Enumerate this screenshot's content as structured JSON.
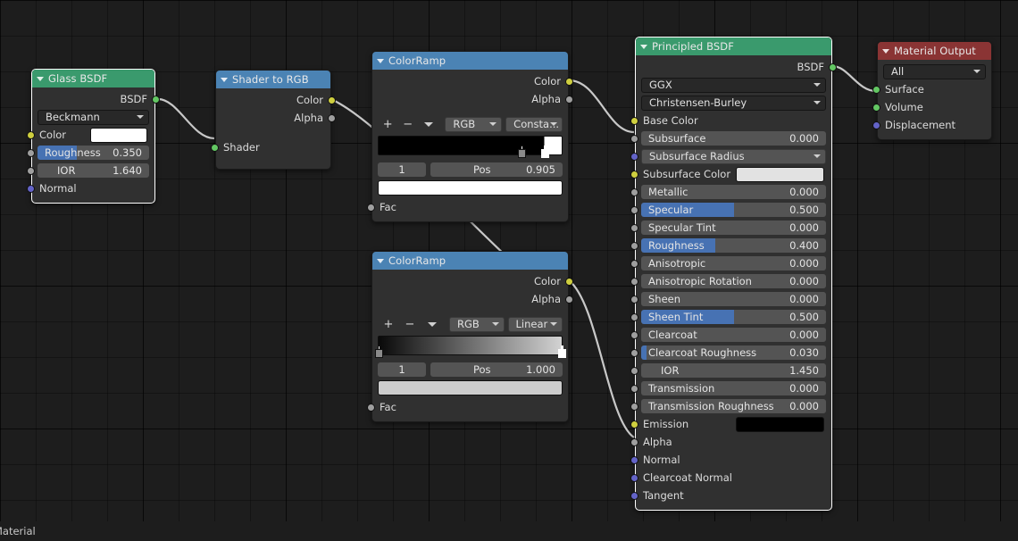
{
  "editor": {
    "background_color": "#1d1d1d",
    "wire_color": "#c8c8c8",
    "statusbar_text": "Material"
  },
  "nodes": {
    "glass_bsdf": {
      "title": "Glass BSDF",
      "header_color": "#3a9a6d",
      "outputs": [
        {
          "label": "BSDF",
          "socket": "shader-socket",
          "color": "#63c763"
        }
      ],
      "distribution": "Beckmann",
      "inputs": [
        {
          "label": "Color",
          "socket": "color-socket",
          "color": "#cfcf3f",
          "widget": "swatch",
          "value": "#ffffff"
        },
        {
          "label": "Roughness",
          "socket": "value-socket",
          "color": "#9f9f9f",
          "widget": "slider",
          "value": "0.350",
          "fill": 35
        },
        {
          "label": "IOR",
          "socket": "value-socket",
          "color": "#9f9f9f",
          "widget": "slider",
          "value": "1.640",
          "fill": 0
        },
        {
          "label": "Normal",
          "socket": "vector-socket",
          "color": "#6363c7",
          "widget": "none",
          "value": ""
        }
      ]
    },
    "shader_to_rgb": {
      "title": "Shader to RGB",
      "header_color": "#4b83b4",
      "outputs": [
        {
          "label": "Color",
          "socket": "color-socket",
          "color": "#cfcf3f"
        },
        {
          "label": "Alpha",
          "socket": "value-socket",
          "color": "#9f9f9f"
        }
      ],
      "inputs": [
        {
          "label": "Shader",
          "socket": "shader-socket",
          "color": "#63c763"
        }
      ]
    },
    "colorramp_1": {
      "title": "ColorRamp",
      "header_color": "#4b83b4",
      "outputs": [
        {
          "label": "Color",
          "socket": "color-socket",
          "color": "#cfcf3f"
        },
        {
          "label": "Alpha",
          "socket": "value-socket",
          "color": "#9f9f9f"
        }
      ],
      "tools": {
        "add": "+",
        "remove": "−",
        "menu": "chevron-down-icon"
      },
      "color_mode": "RGB",
      "interpolation": "Consta...",
      "gradient_css": "linear-gradient(to right, #000000 0%, #000000 90.5%, #ffffff 90.5%, #ffffff 100%)",
      "stops": [
        {
          "pos": 0.0,
          "color": "#000000",
          "selected": false
        },
        {
          "pos": 0.86,
          "color": "#000000",
          "selected": false
        },
        {
          "pos": 0.905,
          "color": "#ffffff",
          "selected": true
        }
      ],
      "index": "1",
      "pos_label": "Pos",
      "pos_value": "0.905",
      "active_color": "#ffffff",
      "inputs": [
        {
          "label": "Fac",
          "socket": "value-socket",
          "color": "#9f9f9f"
        }
      ]
    },
    "colorramp_2": {
      "title": "ColorRamp",
      "header_color": "#4b83b4",
      "outputs": [
        {
          "label": "Color",
          "socket": "color-socket",
          "color": "#cfcf3f"
        },
        {
          "label": "Alpha",
          "socket": "value-socket",
          "color": "#9f9f9f"
        }
      ],
      "tools": {
        "add": "+",
        "remove": "−",
        "menu": "chevron-down-icon"
      },
      "color_mode": "RGB",
      "interpolation": "Linear",
      "gradient_css": "linear-gradient(to right, #090909 0%, #d2d2d2 100%)",
      "stops": [
        {
          "pos": 0.0,
          "color": "#000000",
          "selected": false
        },
        {
          "pos": 1.0,
          "color": "#d2d2d2",
          "selected": true
        }
      ],
      "index": "1",
      "pos_label": "Pos",
      "pos_value": "1.000",
      "active_color": "#cdcdcd",
      "inputs": [
        {
          "label": "Fac",
          "socket": "value-socket",
          "color": "#9f9f9f"
        }
      ]
    },
    "principled_bsdf": {
      "title": "Principled BSDF",
      "header_color": "#3a9a6d",
      "outputs": [
        {
          "label": "BSDF",
          "socket": "shader-socket",
          "color": "#63c763"
        }
      ],
      "distribution": "GGX",
      "subsurface_method": "Christensen-Burley",
      "inputs": [
        {
          "label": "Base Color",
          "socket": "color-socket",
          "color": "#cfcf3f",
          "widget": "none",
          "value": ""
        },
        {
          "label": "Subsurface",
          "socket": "value-socket",
          "color": "#9f9f9f",
          "widget": "slider",
          "value": "0.000",
          "fill": 0
        },
        {
          "label": "Subsurface Radius",
          "socket": "vector-socket",
          "color": "#6363c7",
          "widget": "dropdown",
          "value": ""
        },
        {
          "label": "Subsurface Color",
          "socket": "color-socket",
          "color": "#cfcf3f",
          "widget": "swatch",
          "value": "#e2e2e2"
        },
        {
          "label": "Metallic",
          "socket": "value-socket",
          "color": "#9f9f9f",
          "widget": "slider",
          "value": "0.000",
          "fill": 0
        },
        {
          "label": "Specular",
          "socket": "value-socket",
          "color": "#9f9f9f",
          "widget": "slider",
          "value": "0.500",
          "fill": 50
        },
        {
          "label": "Specular Tint",
          "socket": "value-socket",
          "color": "#9f9f9f",
          "widget": "slider",
          "value": "0.000",
          "fill": 0
        },
        {
          "label": "Roughness",
          "socket": "value-socket",
          "color": "#9f9f9f",
          "widget": "slider",
          "value": "0.400",
          "fill": 40
        },
        {
          "label": "Anisotropic",
          "socket": "value-socket",
          "color": "#9f9f9f",
          "widget": "slider",
          "value": "0.000",
          "fill": 0
        },
        {
          "label": "Anisotropic Rotation",
          "socket": "value-socket",
          "color": "#9f9f9f",
          "widget": "slider",
          "value": "0.000",
          "fill": 0
        },
        {
          "label": "Sheen",
          "socket": "value-socket",
          "color": "#9f9f9f",
          "widget": "slider",
          "value": "0.000",
          "fill": 0
        },
        {
          "label": "Sheen Tint",
          "socket": "value-socket",
          "color": "#9f9f9f",
          "widget": "slider",
          "value": "0.500",
          "fill": 50
        },
        {
          "label": "Clearcoat",
          "socket": "value-socket",
          "color": "#9f9f9f",
          "widget": "slider",
          "value": "0.000",
          "fill": 0
        },
        {
          "label": "Clearcoat Roughness",
          "socket": "value-socket",
          "color": "#9f9f9f",
          "widget": "slider",
          "value": "0.030",
          "fill": 3
        },
        {
          "label": "IOR",
          "socket": "value-socket",
          "color": "#9f9f9f",
          "widget": "slider",
          "value": "1.450",
          "fill": 0,
          "indent": true
        },
        {
          "label": "Transmission",
          "socket": "value-socket",
          "color": "#9f9f9f",
          "widget": "slider",
          "value": "0.000",
          "fill": 0
        },
        {
          "label": "Transmission Roughness",
          "socket": "value-socket",
          "color": "#9f9f9f",
          "widget": "slider",
          "value": "0.000",
          "fill": 0
        },
        {
          "label": "Emission",
          "socket": "color-socket",
          "color": "#cfcf3f",
          "widget": "swatch",
          "value": "#000000"
        },
        {
          "label": "Alpha",
          "socket": "value-socket",
          "color": "#9f9f9f",
          "widget": "none",
          "value": ""
        },
        {
          "label": "Normal",
          "socket": "vector-socket",
          "color": "#6363c7",
          "widget": "none",
          "value": ""
        },
        {
          "label": "Clearcoat Normal",
          "socket": "vector-socket",
          "color": "#6363c7",
          "widget": "none",
          "value": ""
        },
        {
          "label": "Tangent",
          "socket": "vector-socket",
          "color": "#6363c7",
          "widget": "none",
          "value": ""
        }
      ]
    },
    "material_output": {
      "title": "Material Output",
      "header_color": "#8a3434",
      "target": "All",
      "inputs": [
        {
          "label": "Surface",
          "socket": "shader-socket",
          "color": "#63c763"
        },
        {
          "label": "Volume",
          "socket": "shader-socket",
          "color": "#63c763"
        },
        {
          "label": "Displacement",
          "socket": "vector-socket",
          "color": "#6363c7"
        }
      ]
    }
  }
}
